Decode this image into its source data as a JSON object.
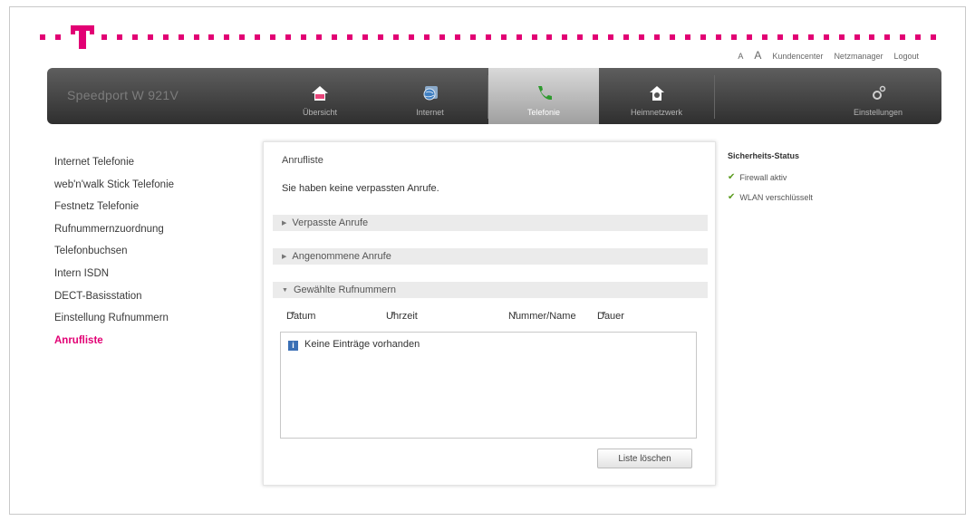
{
  "brand": {
    "accent": "#e20074"
  },
  "utility": {
    "font_small": "A",
    "font_large": "A",
    "links": [
      "Kundencenter",
      "Netzmanager",
      "Logout"
    ]
  },
  "navbar": {
    "product_name": "Speedport W 921V",
    "items": [
      {
        "label": "Übersicht",
        "icon": "house-icon"
      },
      {
        "label": "Internet",
        "icon": "globe-icon"
      },
      {
        "label": "Telefonie",
        "icon": "phone-icon",
        "active": true
      },
      {
        "label": "Heimnetzwerk",
        "icon": "home-network-icon"
      },
      {
        "label": "Einstellungen",
        "icon": "settings-icon"
      }
    ]
  },
  "sidebar": {
    "items": [
      "Internet Telefonie",
      "web'n'walk Stick Telefonie",
      "Festnetz Telefonie",
      "Rufnummernzuordnung",
      "Telefonbuchsen",
      "Intern ISDN",
      "DECT-Basisstation",
      "Einstellung Rufnummern",
      "Anrufliste"
    ],
    "active_index": 8
  },
  "main": {
    "title": "Anrufliste",
    "message": "Sie haben keine verpassten Anrufe.",
    "sections": {
      "missed": "Verpasste Anrufe",
      "accepted": "Angenommene Anrufe",
      "dialed": "Gewählte Rufnummern"
    },
    "columns": {
      "date": "Datum",
      "time": "Uhrzeit",
      "number": "Nummer/Name",
      "duration": "Dauer"
    },
    "empty_text": "Keine Einträge vorhanden",
    "clear_button": "Liste löschen"
  },
  "security": {
    "title": "Sicherheits-Status",
    "items": [
      "Firewall aktiv",
      "WLAN verschlüsselt"
    ]
  }
}
